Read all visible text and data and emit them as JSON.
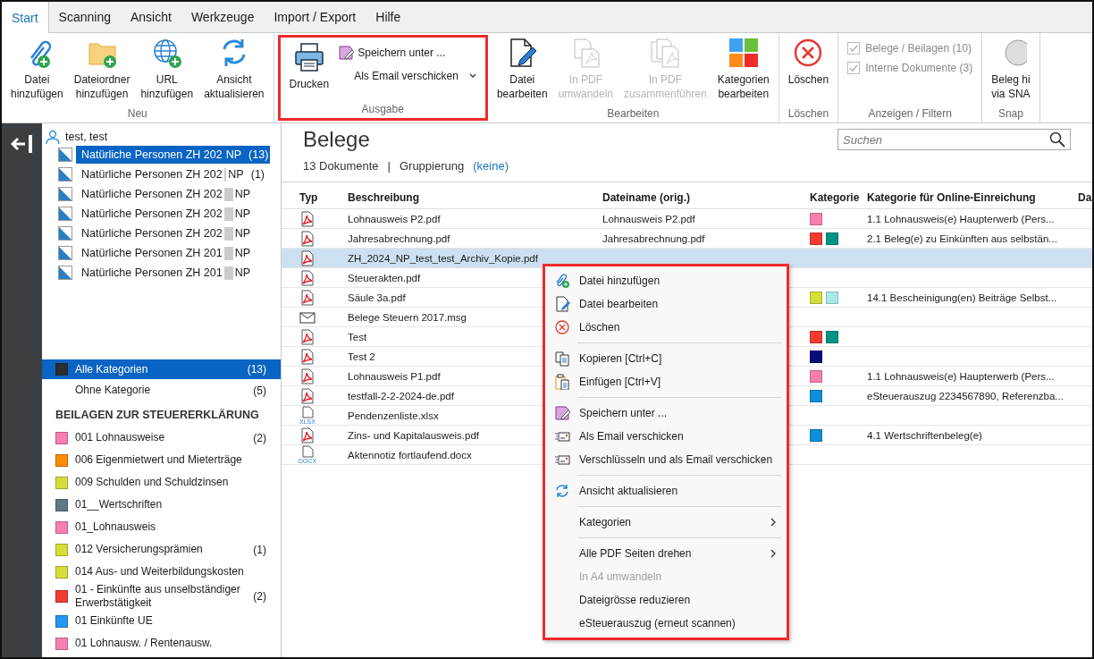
{
  "menu_tabs": [
    {
      "label": "Start",
      "selected": true
    },
    {
      "label": "Scanning",
      "selected": false
    },
    {
      "label": "Ansicht",
      "selected": false
    },
    {
      "label": "Werkzeuge",
      "selected": false
    },
    {
      "label": "Import / Export",
      "selected": false
    },
    {
      "label": "Hilfe",
      "selected": false
    }
  ],
  "ribbon": {
    "groups": [
      {
        "label": "Neu",
        "highlighted": false,
        "items": [
          {
            "kind": "large",
            "label": "Datei\nhinzufügen",
            "disabled": false
          },
          {
            "kind": "large",
            "label": "Dateiordner\nhinzufügen",
            "disabled": false
          },
          {
            "kind": "large",
            "label": "URL\nhinzufügen",
            "disabled": false
          },
          {
            "kind": "large",
            "label": "Ansicht\naktualisieren",
            "disabled": false
          }
        ]
      },
      {
        "label": "Ausgabe",
        "highlighted": true,
        "items": [
          {
            "kind": "large",
            "label": "Drucken",
            "disabled": false
          },
          {
            "kind": "stack",
            "entries": [
              {
                "label": "Speichern unter ...",
                "dropdown": false
              },
              {
                "label": "Als Email verschicken",
                "dropdown": true
              }
            ]
          }
        ]
      },
      {
        "label": "Bearbeiten",
        "highlighted": false,
        "items": [
          {
            "kind": "large",
            "label": "Datei\nbearbeiten",
            "disabled": false
          },
          {
            "kind": "large",
            "label": "In PDF\numwandeln",
            "disabled": true
          },
          {
            "kind": "large",
            "label": "In PDF\nzusammenführen",
            "disabled": true
          },
          {
            "kind": "large",
            "label": "Kategorien\nbearbeiten",
            "disabled": false
          }
        ]
      },
      {
        "label": "Löschen",
        "highlighted": false,
        "items": [
          {
            "kind": "large",
            "label": "Löschen",
            "disabled": false
          }
        ]
      },
      {
        "label": "Anzeigen / Filtern",
        "highlighted": false,
        "items": [
          {
            "kind": "checks",
            "entries": [
              {
                "label": "Belege / Beilagen (10)",
                "checked": true,
                "disabled": true
              },
              {
                "label": "Interne Dokumente (3)",
                "checked": true,
                "disabled": true
              }
            ]
          }
        ]
      },
      {
        "label": "Snap",
        "highlighted": false,
        "items": [
          {
            "kind": "large",
            "label": "Beleg hi\nvia SNA",
            "disabled": false
          }
        ]
      }
    ]
  },
  "tree": {
    "account": "test, test",
    "items": [
      {
        "label": "Natürliche Personen ZH 202",
        "suffix": "NP",
        "count": "(13)",
        "selected": true
      },
      {
        "label": "Natürliche Personen ZH 202",
        "suffix": "NP",
        "count": "(1)",
        "selected": false
      },
      {
        "label": "Natürliche Personen ZH 202",
        "suffix": "NP",
        "selected": false
      },
      {
        "label": "Natürliche Personen ZH 202",
        "suffix": "NP",
        "selected": false
      },
      {
        "label": "Natürliche Personen ZH 202",
        "suffix": "NP",
        "selected": false
      },
      {
        "label": "Natürliche Personen ZH 201",
        "suffix": "NP",
        "selected": false
      },
      {
        "label": "Natürliche Personen ZH 201",
        "suffix": "NP",
        "selected": false
      }
    ]
  },
  "categories": {
    "items": [
      {
        "label": "Alle Kategorien",
        "count": "(13)",
        "color": "#2b2f33",
        "selected": true
      },
      {
        "label": "Ohne Kategorie",
        "count": "(5)",
        "selected": false
      }
    ],
    "section_title": "BEILAGEN ZUR STEUERERKLÄRUNG",
    "section_items": [
      {
        "label": "001 Lohnausweise",
        "count": "(2)",
        "color": "#f77fb0"
      },
      {
        "label": "006 Eigenmietwert und Mieterträge",
        "color": "#ff8c00"
      },
      {
        "label": "009 Schulden und Schuldzinsen",
        "color": "#d4de3a"
      },
      {
        "label": "01__Wertschriften",
        "color": "#607885"
      },
      {
        "label": "01_Lohnausweis",
        "color": "#f77fb0"
      },
      {
        "label": "012 Versicherungsprämien",
        "count": "(1)",
        "color": "#d4de3a"
      },
      {
        "label": "014 Aus- und Weiterbildungskosten",
        "color": "#d4de3a"
      },
      {
        "label": "01 - Einkünfte aus unselbständiger Erwerbstätigkeit",
        "count": "(2)",
        "color": "#f23c32"
      },
      {
        "label": "01 Einkünfte UE",
        "color": "#2196f3"
      },
      {
        "label": "01 Lohnausw. / Rentenausw.",
        "color": "#f77fb0"
      }
    ]
  },
  "main": {
    "title": "Belege",
    "document_count": "13 Dokumente",
    "separator": "|",
    "grouping_label": "Gruppierung",
    "grouping_value": "(keine)",
    "search": {
      "placeholder": "Suchen"
    }
  },
  "table": {
    "columns": [
      "Typ",
      "Beschreibung",
      "Dateiname (orig.)",
      "Kategorie",
      "Kategorie für Online-Einreichung",
      "Da"
    ],
    "rows": [
      {
        "kind": "pdf",
        "description": "Lohnausweis P2.pdf",
        "filename": "Lohnausweis P2.pdf",
        "colors": [
          {
            "color": "#f77fb0"
          }
        ],
        "online": "1.1 Lohnausweis(e) Haupterwerb (Pers...",
        "selected": false
      },
      {
        "kind": "pdf",
        "description": "Jahresabrechnung.pdf",
        "filename": "Jahresabrechnung.pdf",
        "colors": [
          {
            "color": "#f23c32"
          },
          {
            "color": "#009485"
          }
        ],
        "online": "2.1 Beleg(e) zu Einkünften aus selbstän...",
        "selected": false
      },
      {
        "kind": "pdf",
        "description": "ZH_2024_NP_test_test_Archiv_Kopie.pdf",
        "colors": [],
        "selected": true
      },
      {
        "kind": "pdf",
        "description": "Steuerakten.pdf",
        "colors": [],
        "selected": false
      },
      {
        "kind": "pdf",
        "description": "Säule 3a.pdf",
        "colors": [
          {
            "color": "#d4de3a"
          },
          {
            "color": "#a8e8e8"
          }
        ],
        "online": "14.1 Bescheinigung(en) Beiträge Selbst...",
        "selected": false
      },
      {
        "kind": "msg",
        "description": "Belege Steuern 2017.msg",
        "colors": [],
        "selected": false
      },
      {
        "kind": "pdf",
        "description": "Test",
        "colors": [
          {
            "color": "#f23c32"
          },
          {
            "color": "#009485"
          }
        ],
        "selected": false
      },
      {
        "kind": "pdf",
        "description": "Test 2",
        "colors": [
          {
            "color": "#0a0a78"
          }
        ],
        "selected": false
      },
      {
        "kind": "pdf",
        "description": "Lohnausweis P1.pdf",
        "colors": [
          {
            "color": "#f77fb0"
          }
        ],
        "online": "1.1 Lohnausweis(e) Haupterwerb (Pers...",
        "selected": false
      },
      {
        "kind": "pdf",
        "description": "testfall-2-2-2024-de.pdf",
        "colors": [
          {
            "color": "#0a90d8"
          }
        ],
        "online": "eSteuerauszug 2234567890, Referenzba...",
        "selected": false
      },
      {
        "kind": "xlsx",
        "type_label": "XLSX",
        "description": "Pendenzenliste.xlsx",
        "colors": [],
        "selected": false
      },
      {
        "kind": "pdf",
        "description": "Zins- und Kapitalausweis.pdf",
        "colors": [
          {
            "color": "#0a90d8"
          }
        ],
        "online": "4.1 Wertschriftenbeleg(e)",
        "selected": false
      },
      {
        "kind": "docx",
        "type_label": "DOCX",
        "description": "Aktennotiz fortlaufend.docx",
        "colors": [],
        "selected": false
      }
    ]
  },
  "context_menu": {
    "highlighted": true,
    "items": [
      {
        "kind": "item",
        "label": "Datei hinzufügen",
        "disabled": false,
        "submenu": false
      },
      {
        "kind": "item",
        "label": "Datei bearbeiten",
        "disabled": false,
        "submenu": false
      },
      {
        "kind": "item",
        "label": "Löschen",
        "disabled": false,
        "submenu": false
      },
      {
        "kind": "separator"
      },
      {
        "kind": "item",
        "label": "Kopieren [Ctrl+C]",
        "disabled": false,
        "submenu": false
      },
      {
        "kind": "item",
        "label": "Einfügen [Ctrl+V]",
        "disabled": false,
        "submenu": false
      },
      {
        "kind": "separator"
      },
      {
        "kind": "item",
        "label": "Speichern unter ...",
        "disabled": false,
        "submenu": false
      },
      {
        "kind": "item",
        "label": "Als Email verschicken",
        "disabled": false,
        "submenu": false
      },
      {
        "kind": "item",
        "label": "Verschlüsseln und als Email verschicken",
        "disabled": false,
        "submenu": false
      },
      {
        "kind": "separator"
      },
      {
        "kind": "item",
        "label": "Ansicht aktualisieren",
        "disabled": false,
        "submenu": false
      },
      {
        "kind": "separator"
      },
      {
        "kind": "item",
        "label": "Kategorien",
        "disabled": false,
        "submenu": true
      },
      {
        "kind": "separator"
      },
      {
        "kind": "item",
        "label": "Alle PDF Seiten drehen",
        "disabled": false,
        "submenu": true
      },
      {
        "kind": "item",
        "label": "In A4 umwandeln",
        "disabled": true,
        "submenu": false
      },
      {
        "kind": "item",
        "label": "Dateigrösse reduzieren",
        "disabled": false,
        "submenu": false
      },
      {
        "kind": "item",
        "label": "eSteuerauszug (erneut scannen)",
        "disabled": false,
        "submenu": false
      }
    ]
  }
}
